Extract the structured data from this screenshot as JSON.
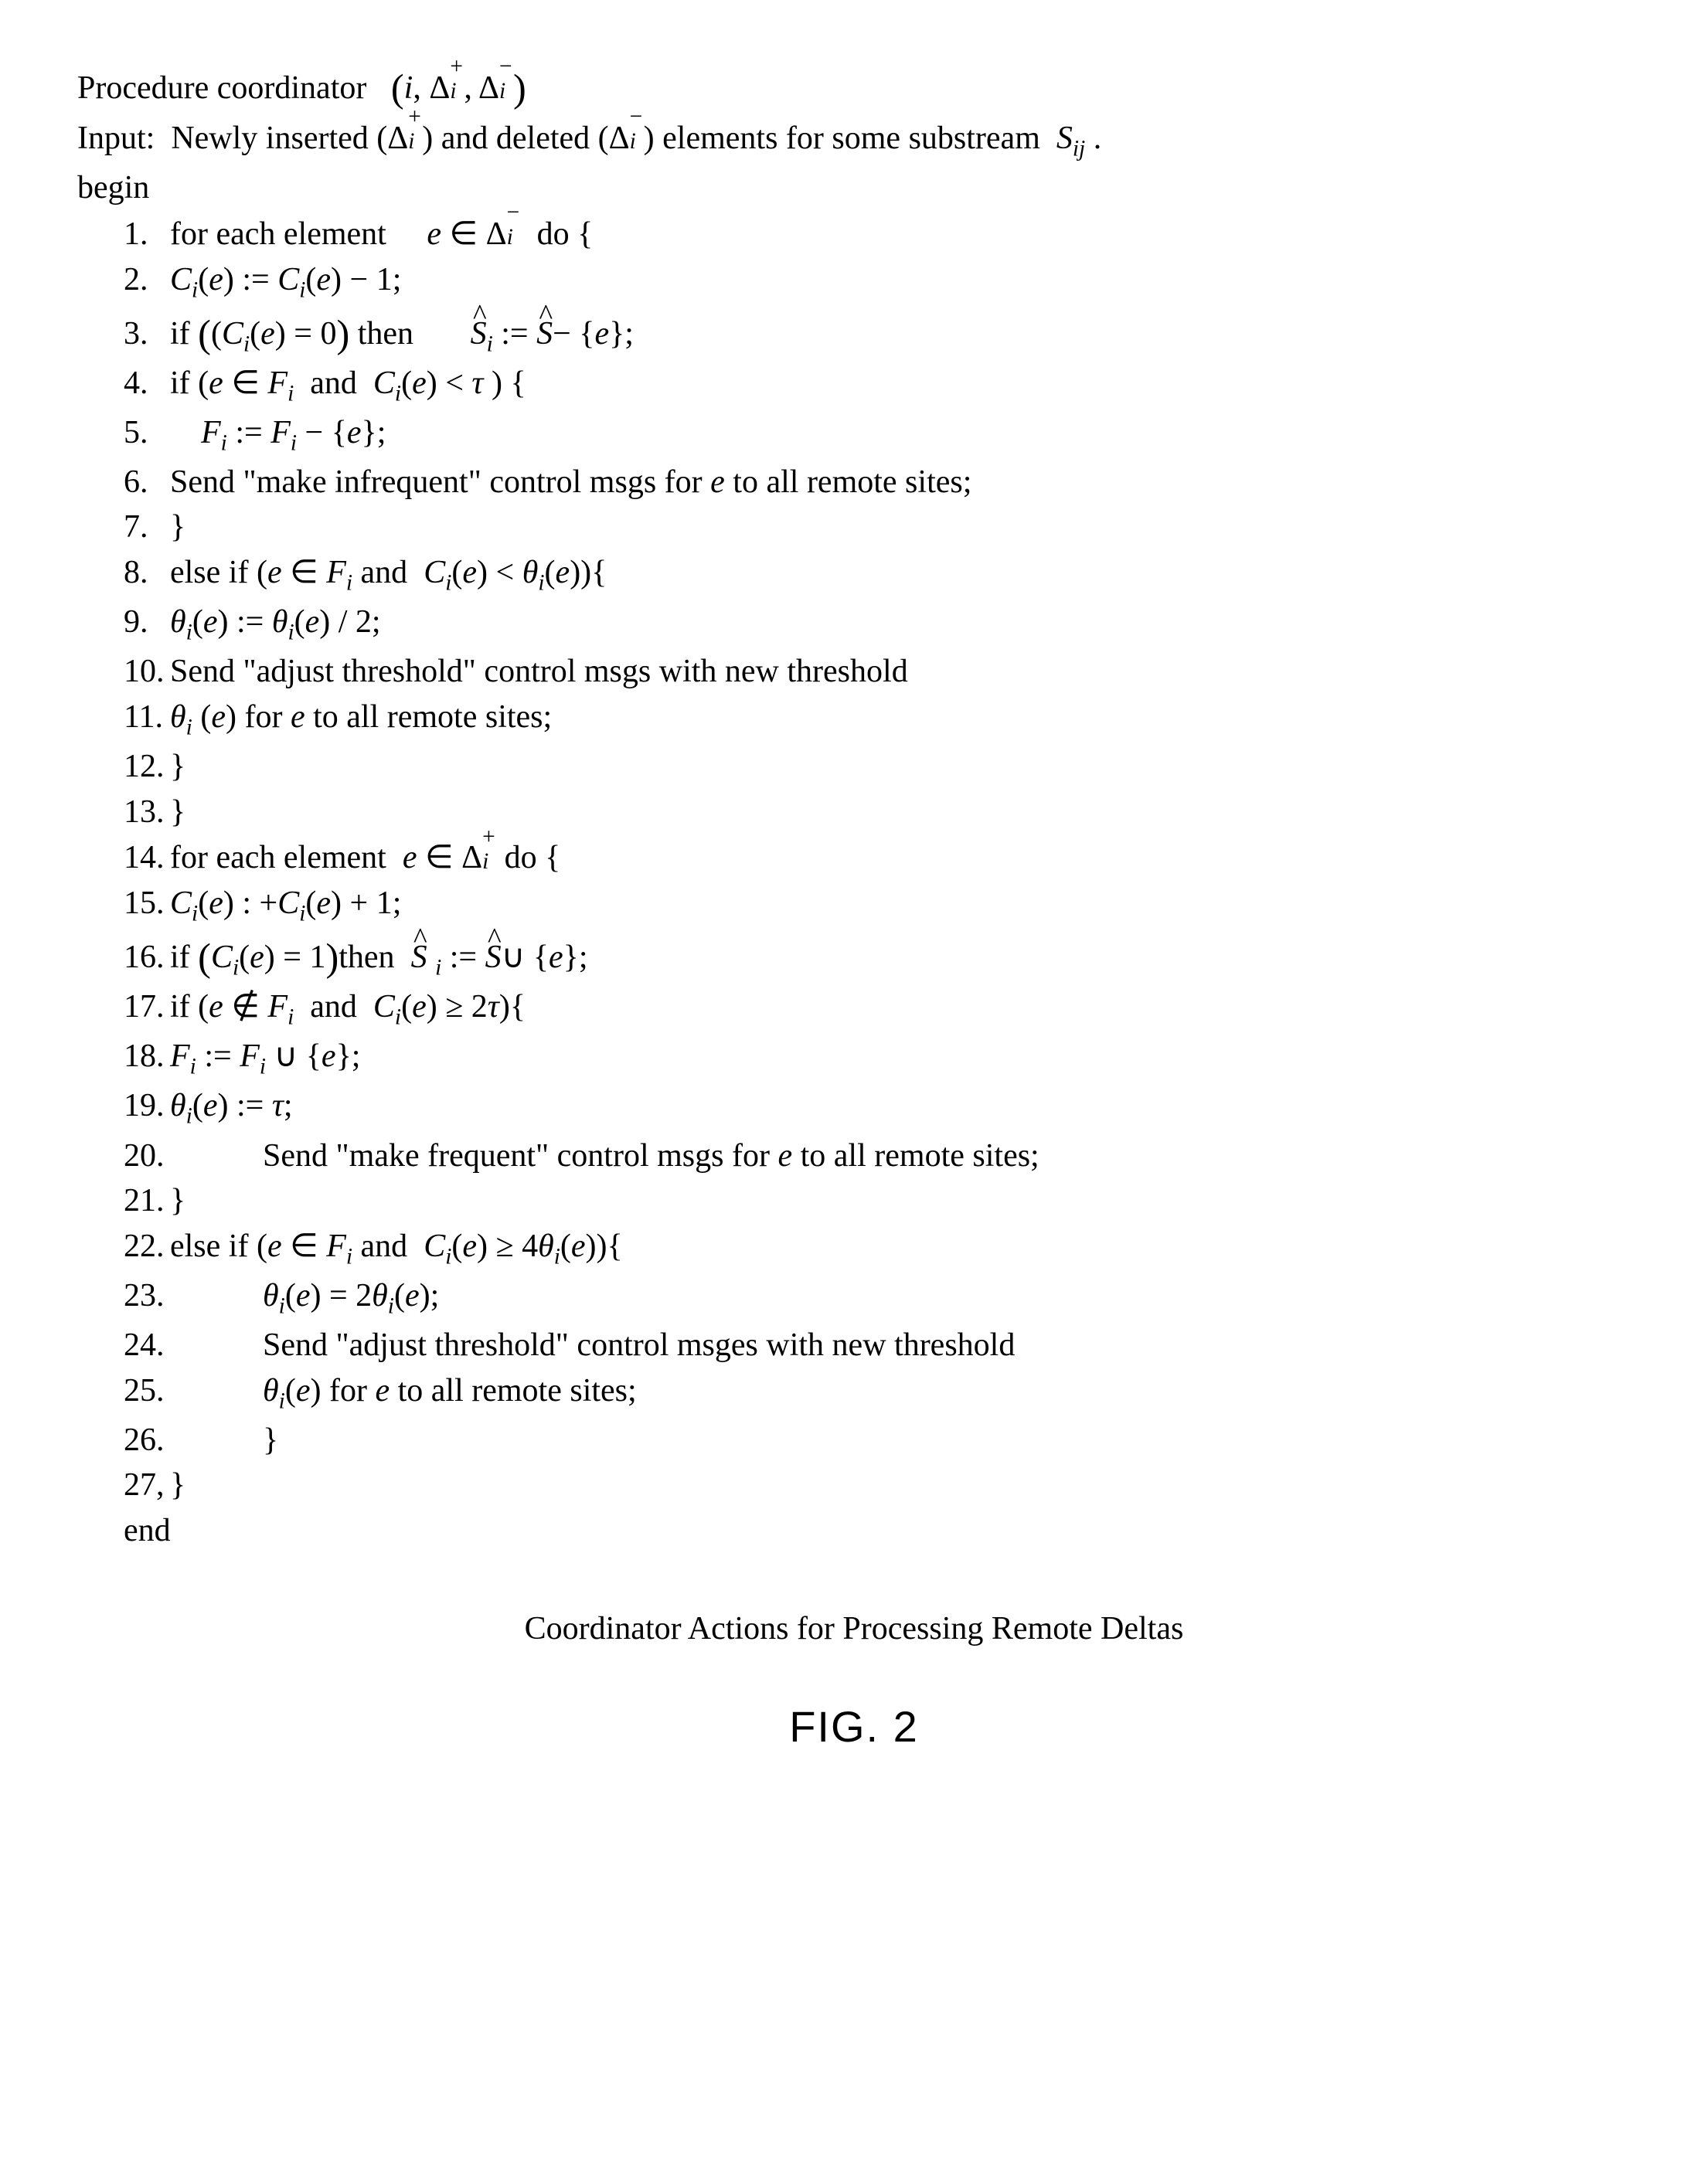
{
  "header": {
    "title_prefix": "Procedure coordinator",
    "title_args": "(i, Δᵢ⁺, Δᵢ⁻)",
    "input_label": "Input:",
    "input_text_a": "Newly inserted (",
    "input_text_b": ") and deleted (",
    "input_text_c": ") elements for some substream",
    "input_text_d": ".",
    "begin": "begin",
    "end": "end"
  },
  "caption": "Coordinator Actions for Processing Remote Deltas",
  "fig_label": "FIG. 2",
  "lines": {
    "l1": {
      "num": "1.",
      "text": "for each element"
    },
    "l2": {
      "num": "2."
    },
    "l3": {
      "num": "3."
    },
    "l4": {
      "num": "4."
    },
    "l5": {
      "num": "5."
    },
    "l6": {
      "num": "6.",
      "text": "Send \"make infrequent\" control msgs for e to all remote sites;"
    },
    "l7": {
      "num": "7.",
      "text": "}"
    },
    "l8": {
      "num": "8."
    },
    "l9": {
      "num": "9."
    },
    "l10": {
      "num": "10.",
      "text": "Send \"adjust threshold\" control msgs with new threshold"
    },
    "l11": {
      "num": "11."
    },
    "l12": {
      "num": "12.",
      "text": "}"
    },
    "l13": {
      "num": "13.",
      "text": "}"
    },
    "l14": {
      "num": "14."
    },
    "l15": {
      "num": "15."
    },
    "l16": {
      "num": "16."
    },
    "l17": {
      "num": "17."
    },
    "l18": {
      "num": "18."
    },
    "l19": {
      "num": "19."
    },
    "l20": {
      "num": "20.",
      "text": "Send \"make frequent\" control msgs for e to all remote sites;"
    },
    "l21": {
      "num": "21.",
      "text": "}"
    },
    "l22": {
      "num": "22."
    },
    "l23": {
      "num": "23."
    },
    "l24": {
      "num": "24.",
      "text": "Send \"adjust threshold\" control msges with new threshold"
    },
    "l25": {
      "num": "25."
    },
    "l26": {
      "num": "26.",
      "text": "}"
    },
    "l27": {
      "num": "27,",
      "text": "}"
    }
  }
}
